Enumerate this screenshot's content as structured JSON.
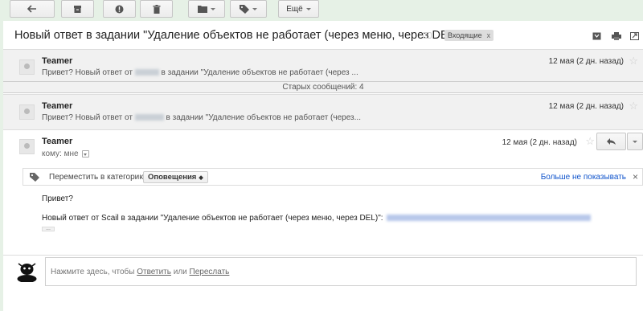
{
  "toolbar": {
    "buttons": [
      {
        "icon": "back-arrow-icon"
      },
      {
        "icon": "archive-icon"
      },
      {
        "icon": "report-spam-icon"
      },
      {
        "icon": "trash-icon"
      },
      {
        "icon": "folder-move-icon"
      },
      {
        "icon": "label-tag-icon"
      }
    ],
    "more_label": "Ещё"
  },
  "thread": {
    "subject": "Новый ответ в задании \"Удаление объектов не работает (через меню, через DEL)\"",
    "label_chip": "Входящие",
    "label_chip_close": "x"
  },
  "messages": [
    {
      "sender": "Teamer",
      "snippet_before": "Привет? Новый ответ от",
      "snippet_after": "в задании \"Удаление объектов не работает (через ...",
      "date": "12 мая (2 дн. назад)",
      "star": "☆"
    },
    {
      "sender": "Teamer",
      "snippet_before": "Привет? Новый ответ от",
      "snippet_after": "в задании \"Удаление объектов не работает (через...",
      "date": "12 мая (2 дн. назад)",
      "star": "☆"
    }
  ],
  "older_messages": "Старых сообщений: 4",
  "open_message": {
    "sender": "Teamer",
    "to_line": "кому: мне",
    "date": "12 мая (2 дн. назад)",
    "star": "☆",
    "category_bar": {
      "label": "Переместить в категорию:",
      "selected": "Оповещения",
      "dismiss": "Больше не показывать",
      "close": "×"
    },
    "body_line1": "Привет?",
    "body_line2": "Новый ответ от Scail в задании \"Удаление объектов не работает (через меню, через DEL)\":",
    "ellipsis": "..."
  },
  "reply": {
    "prompt_prefix": "Нажмите здесь, чтобы",
    "reply_link": "Ответить",
    "or": "или",
    "forward_link": "Переслать"
  },
  "colors": {
    "frame_green": "#e6f1e6",
    "collapsed_bg": "#f1f1f1",
    "link_blue": "#1155cc"
  }
}
